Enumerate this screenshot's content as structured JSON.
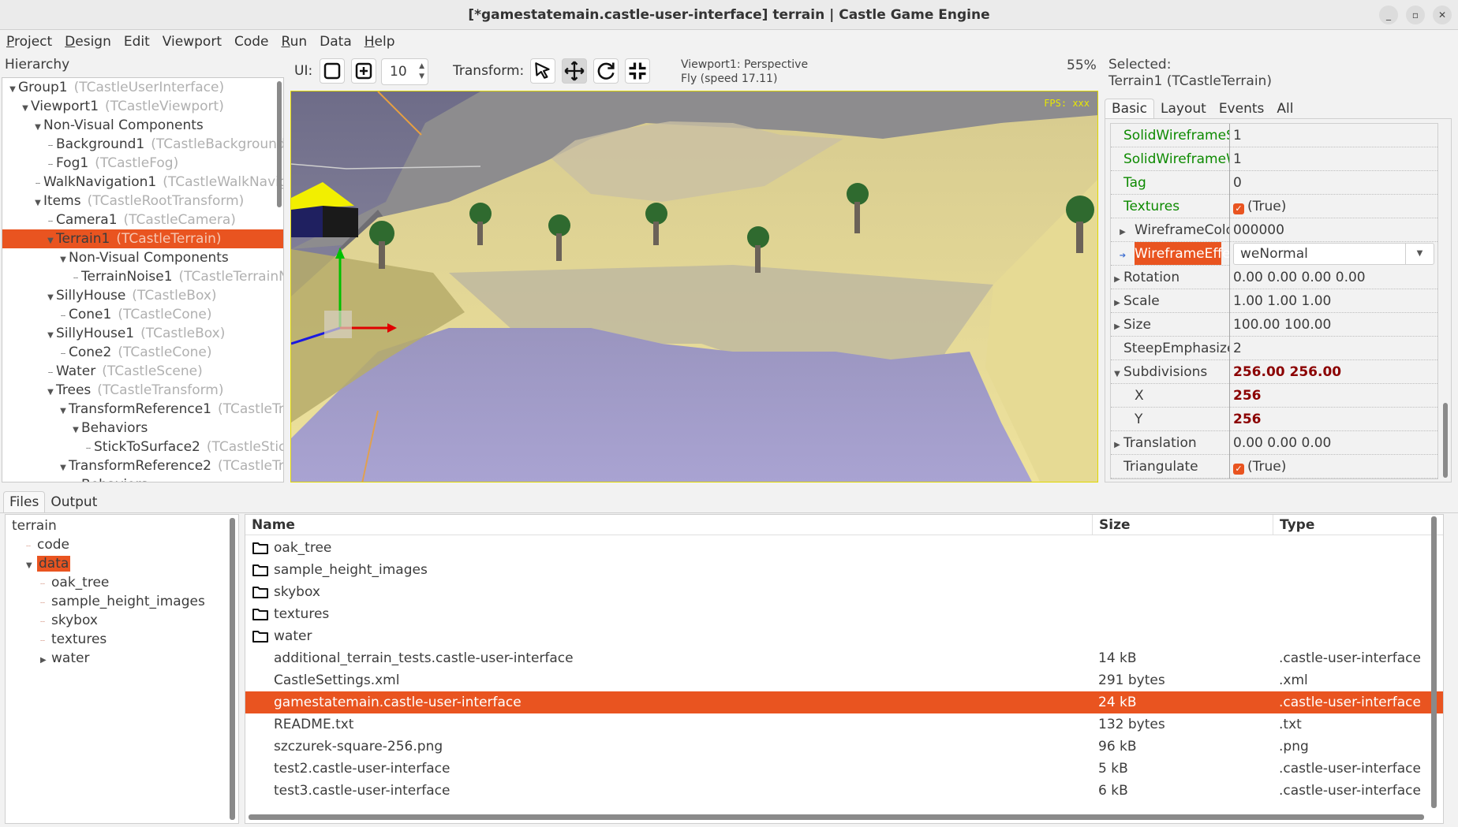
{
  "window": {
    "title": "[*gamestatemain.castle-user-interface] terrain | Castle Game Engine",
    "controls": [
      "minimize",
      "maximize",
      "close"
    ]
  },
  "menu": [
    {
      "label": "Project",
      "mnemonic": "P"
    },
    {
      "label": "Design",
      "mnemonic": "D"
    },
    {
      "label": "Edit",
      "mnemonic": ""
    },
    {
      "label": "Viewport",
      "mnemonic": ""
    },
    {
      "label": "Code",
      "mnemonic": ""
    },
    {
      "label": "Run",
      "mnemonic": "R"
    },
    {
      "label": "Data",
      "mnemonic": ""
    },
    {
      "label": "Help",
      "mnemonic": "H"
    }
  ],
  "hierarchy": {
    "label": "Hierarchy",
    "items": [
      {
        "name": "Group1",
        "type": "(TCastleUserInterface)",
        "depth": 0,
        "expanded": true
      },
      {
        "name": "Viewport1",
        "type": "(TCastleViewport)",
        "depth": 1,
        "expanded": true
      },
      {
        "name": "Non-Visual Components",
        "type": "",
        "depth": 2,
        "expanded": true
      },
      {
        "name": "Background1",
        "type": "(TCastleBackground)",
        "depth": 3
      },
      {
        "name": "Fog1",
        "type": "(TCastleFog)",
        "depth": 3
      },
      {
        "name": "WalkNavigation1",
        "type": "(TCastleWalkNavigation)",
        "depth": 2
      },
      {
        "name": "Items",
        "type": "(TCastleRootTransform)",
        "depth": 2,
        "expanded": true
      },
      {
        "name": "Camera1",
        "type": "(TCastleCamera)",
        "depth": 3
      },
      {
        "name": "Terrain1",
        "type": "(TCastleTerrain)",
        "depth": 3,
        "expanded": true,
        "selected": true
      },
      {
        "name": "Non-Visual Components",
        "type": "",
        "depth": 4,
        "expanded": true
      },
      {
        "name": "TerrainNoise1",
        "type": "(TCastleTerrainNoise)",
        "depth": 5
      },
      {
        "name": "SillyHouse",
        "type": "(TCastleBox)",
        "depth": 3,
        "expanded": true
      },
      {
        "name": "Cone1",
        "type": "(TCastleCone)",
        "depth": 4
      },
      {
        "name": "SillyHouse1",
        "type": "(TCastleBox)",
        "depth": 3,
        "expanded": true
      },
      {
        "name": "Cone2",
        "type": "(TCastleCone)",
        "depth": 4
      },
      {
        "name": "Water",
        "type": "(TCastleScene)",
        "depth": 3
      },
      {
        "name": "Trees",
        "type": "(TCastleTransform)",
        "depth": 3,
        "expanded": true
      },
      {
        "name": "TransformReference1",
        "type": "(TCastleTransformReference)",
        "depth": 4,
        "expanded": true
      },
      {
        "name": "Behaviors",
        "type": "",
        "depth": 5,
        "expanded": true
      },
      {
        "name": "StickToSurface2",
        "type": "(TCastleStickToSurface)",
        "depth": 6
      },
      {
        "name": "TransformReference2",
        "type": "(TCastleTransformReference)",
        "depth": 4,
        "expanded": true
      },
      {
        "name": "Behaviors",
        "type": "",
        "depth": 5,
        "expanded": true
      }
    ]
  },
  "toolbar": {
    "ui_label": "UI:",
    "ui_buttons": [
      "rectangle-tool",
      "add-tool"
    ],
    "snap_value": "10",
    "transform_label": "Transform:",
    "transform_buttons": [
      {
        "icon": "select-cursor-icon",
        "active": false
      },
      {
        "icon": "move-arrows-icon",
        "active": true
      },
      {
        "icon": "rotate-icon",
        "active": false
      },
      {
        "icon": "scale-icon",
        "active": false
      }
    ],
    "viewport_info_line1": "Viewport1: Perspective",
    "viewport_info_line2": "Fly (speed 17.11)",
    "zoom": "55%"
  },
  "viewport": {
    "fps_text": "FPS: xxx"
  },
  "inspector": {
    "selected_label": "Selected:",
    "selected_value": "Terrain1 (TCastleTerrain)",
    "tabs": [
      {
        "label": "Basic",
        "active": true
      },
      {
        "label": "Layout",
        "active": false
      },
      {
        "label": "Events",
        "active": false
      },
      {
        "label": "All",
        "active": false
      }
    ],
    "properties": [
      {
        "name": "SolidWireframeScale",
        "value": "1",
        "style": "green"
      },
      {
        "name": "SolidWireframeWidth",
        "value": "1",
        "style": "green"
      },
      {
        "name": "Tag",
        "value": "0",
        "style": "green"
      },
      {
        "name": "Textures",
        "value": "(True)",
        "checkbox": true,
        "style": "green"
      },
      {
        "name": "WireframeColor",
        "value": "000000",
        "expandable": true,
        "indent": 1
      },
      {
        "name": "WireframeEffect",
        "value": "weNormal",
        "combo": true,
        "selected": true,
        "indent": 1
      },
      {
        "name": "Rotation",
        "value": "0.00 0.00 0.00 0.00",
        "expandable": true
      },
      {
        "name": "Scale",
        "value": "1.00 1.00 1.00",
        "expandable": true
      },
      {
        "name": "Size",
        "value": "100.00 100.00",
        "expandable": true
      },
      {
        "name": "SteepEmphasize",
        "value": "2"
      },
      {
        "name": "Subdivisions",
        "value": "256.00 256.00",
        "expanded": true,
        "modified": true
      },
      {
        "name": "X",
        "value": "256",
        "modified": true,
        "indent": 1
      },
      {
        "name": "Y",
        "value": "256",
        "modified": true,
        "indent": 1
      },
      {
        "name": "Translation",
        "value": "0.00 0.00 0.00",
        "expandable": true
      },
      {
        "name": "Triangulate",
        "value": "(True)",
        "checkbox": true
      }
    ]
  },
  "bottom": {
    "tabs": [
      {
        "label": "Files",
        "active": true
      },
      {
        "label": "Output",
        "active": false
      }
    ],
    "files_tree": [
      {
        "name": "terrain",
        "depth": 0
      },
      {
        "name": "code",
        "depth": 1
      },
      {
        "name": "data",
        "depth": 1,
        "expanded": true,
        "selected": true
      },
      {
        "name": "oak_tree",
        "depth": 2
      },
      {
        "name": "sample_height_images",
        "depth": 2
      },
      {
        "name": "skybox",
        "depth": 2
      },
      {
        "name": "textures",
        "depth": 2
      },
      {
        "name": "water",
        "depth": 2,
        "collapsed": true
      }
    ],
    "file_list": {
      "columns": [
        "Name",
        "Size",
        "Type"
      ],
      "rows": [
        {
          "name": "oak_tree",
          "size": "",
          "type": "",
          "folder": true
        },
        {
          "name": "sample_height_images",
          "size": "",
          "type": "",
          "folder": true
        },
        {
          "name": "skybox",
          "size": "",
          "type": "",
          "folder": true
        },
        {
          "name": "textures",
          "size": "",
          "type": "",
          "folder": true
        },
        {
          "name": "water",
          "size": "",
          "type": "",
          "folder": true
        },
        {
          "name": "additional_terrain_tests.castle-user-interface",
          "size": "14 kB",
          "type": ".castle-user-interface"
        },
        {
          "name": "CastleSettings.xml",
          "size": "291 bytes",
          "type": ".xml"
        },
        {
          "name": "gamestatemain.castle-user-interface",
          "size": "24 kB",
          "type": ".castle-user-interface",
          "selected": true
        },
        {
          "name": "README.txt",
          "size": "132 bytes",
          "type": ".txt"
        },
        {
          "name": "szczurek-square-256.png",
          "size": "96 kB",
          "type": ".png"
        },
        {
          "name": "test2.castle-user-interface",
          "size": "5 kB",
          "type": ".castle-user-interface"
        },
        {
          "name": "test3.castle-user-interface",
          "size": "6 kB",
          "type": ".castle-user-interface"
        }
      ]
    }
  },
  "colors": {
    "accent": "#e95420",
    "modified_value": "#8b0000",
    "published_property": "#0d8a00",
    "fps_text": "#e8e800"
  }
}
